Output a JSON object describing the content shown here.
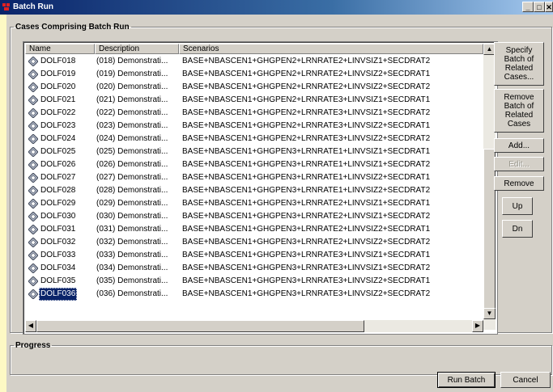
{
  "window": {
    "title": "Batch Run",
    "controls": {
      "minimize": "_",
      "maximize": "□",
      "close": "✕"
    }
  },
  "cases_group": {
    "title": "Cases Comprising Batch Run",
    "columns": [
      "Name",
      "Description",
      "Scenarios"
    ],
    "rows": [
      {
        "name": "DOLF018",
        "description": "(018) Demonstrati...",
        "scenarios": "BASE+NBASCEN1+GHGPEN2+LRNRATE2+LINVSIZ1+SECDRAT2"
      },
      {
        "name": "DOLF019",
        "description": "(019) Demonstrati...",
        "scenarios": "BASE+NBASCEN1+GHGPEN2+LRNRATE2+LINVSIZ2+SECDRAT1"
      },
      {
        "name": "DOLF020",
        "description": "(020) Demonstrati...",
        "scenarios": "BASE+NBASCEN1+GHGPEN2+LRNRATE2+LINVSIZ2+SECDRAT2"
      },
      {
        "name": "DOLF021",
        "description": "(021) Demonstrati...",
        "scenarios": "BASE+NBASCEN1+GHGPEN2+LRNRATE3+LINVSIZ1+SECDRAT1"
      },
      {
        "name": "DOLF022",
        "description": "(022) Demonstrati...",
        "scenarios": "BASE+NBASCEN1+GHGPEN2+LRNRATE3+LINVSIZ1+SECDRAT2"
      },
      {
        "name": "DOLF023",
        "description": "(023) Demonstrati...",
        "scenarios": "BASE+NBASCEN1+GHGPEN2+LRNRATE3+LINVSIZ2+SECDRAT1"
      },
      {
        "name": "DOLF024",
        "description": "(024) Demonstrati...",
        "scenarios": "BASE+NBASCEN1+GHGPEN2+LRNRATE3+LINVSIZ2+SECDRAT2"
      },
      {
        "name": "DOLF025",
        "description": "(025) Demonstrati...",
        "scenarios": "BASE+NBASCEN1+GHGPEN3+LRNRATE1+LINVSIZ1+SECDRAT1"
      },
      {
        "name": "DOLF026",
        "description": "(026) Demonstrati...",
        "scenarios": "BASE+NBASCEN1+GHGPEN3+LRNRATE1+LINVSIZ1+SECDRAT2"
      },
      {
        "name": "DOLF027",
        "description": "(027) Demonstrati...",
        "scenarios": "BASE+NBASCEN1+GHGPEN3+LRNRATE1+LINVSIZ2+SECDRAT1"
      },
      {
        "name": "DOLF028",
        "description": "(028) Demonstrati...",
        "scenarios": "BASE+NBASCEN1+GHGPEN3+LRNRATE1+LINVSIZ2+SECDRAT2"
      },
      {
        "name": "DOLF029",
        "description": "(029) Demonstrati...",
        "scenarios": "BASE+NBASCEN1+GHGPEN3+LRNRATE2+LINVSIZ1+SECDRAT1"
      },
      {
        "name": "DOLF030",
        "description": "(030) Demonstrati...",
        "scenarios": "BASE+NBASCEN1+GHGPEN3+LRNRATE2+LINVSIZ1+SECDRAT2"
      },
      {
        "name": "DOLF031",
        "description": "(031) Demonstrati...",
        "scenarios": "BASE+NBASCEN1+GHGPEN3+LRNRATE2+LINVSIZ2+SECDRAT1"
      },
      {
        "name": "DOLF032",
        "description": "(032) Demonstrati...",
        "scenarios": "BASE+NBASCEN1+GHGPEN3+LRNRATE2+LINVSIZ2+SECDRAT2"
      },
      {
        "name": "DOLF033",
        "description": "(033) Demonstrati...",
        "scenarios": "BASE+NBASCEN1+GHGPEN3+LRNRATE3+LINVSIZ1+SECDRAT1"
      },
      {
        "name": "DOLF034",
        "description": "(034) Demonstrati...",
        "scenarios": "BASE+NBASCEN1+GHGPEN3+LRNRATE3+LINVSIZ1+SECDRAT2"
      },
      {
        "name": "DOLF035",
        "description": "(035) Demonstrati...",
        "scenarios": "BASE+NBASCEN1+GHGPEN3+LRNRATE3+LINVSIZ2+SECDRAT1"
      },
      {
        "name": "DOLF036",
        "description": "(036) Demonstrati...",
        "scenarios": "BASE+NBASCEN1+GHGPEN3+LRNRATE3+LINVSIZ2+SECDRAT2",
        "selected": true
      }
    ],
    "row_icon": "case-icon",
    "buttons": {
      "specify": "Specify Batch of Related Cases...",
      "remove_batch": "Remove Batch of Related Cases",
      "add": "Add...",
      "edit": "Edit...",
      "remove": "Remove",
      "up": "Up",
      "down": "Dn"
    }
  },
  "progress_group": {
    "title": "Progress"
  },
  "footer": {
    "run_batch": "Run Batch",
    "cancel": "Cancel"
  },
  "colors": {
    "selection": "#0a246a",
    "dialog_bg": "#d4d0c8",
    "titlebar": "#0a246a",
    "desktop": "#fdf9c4"
  }
}
